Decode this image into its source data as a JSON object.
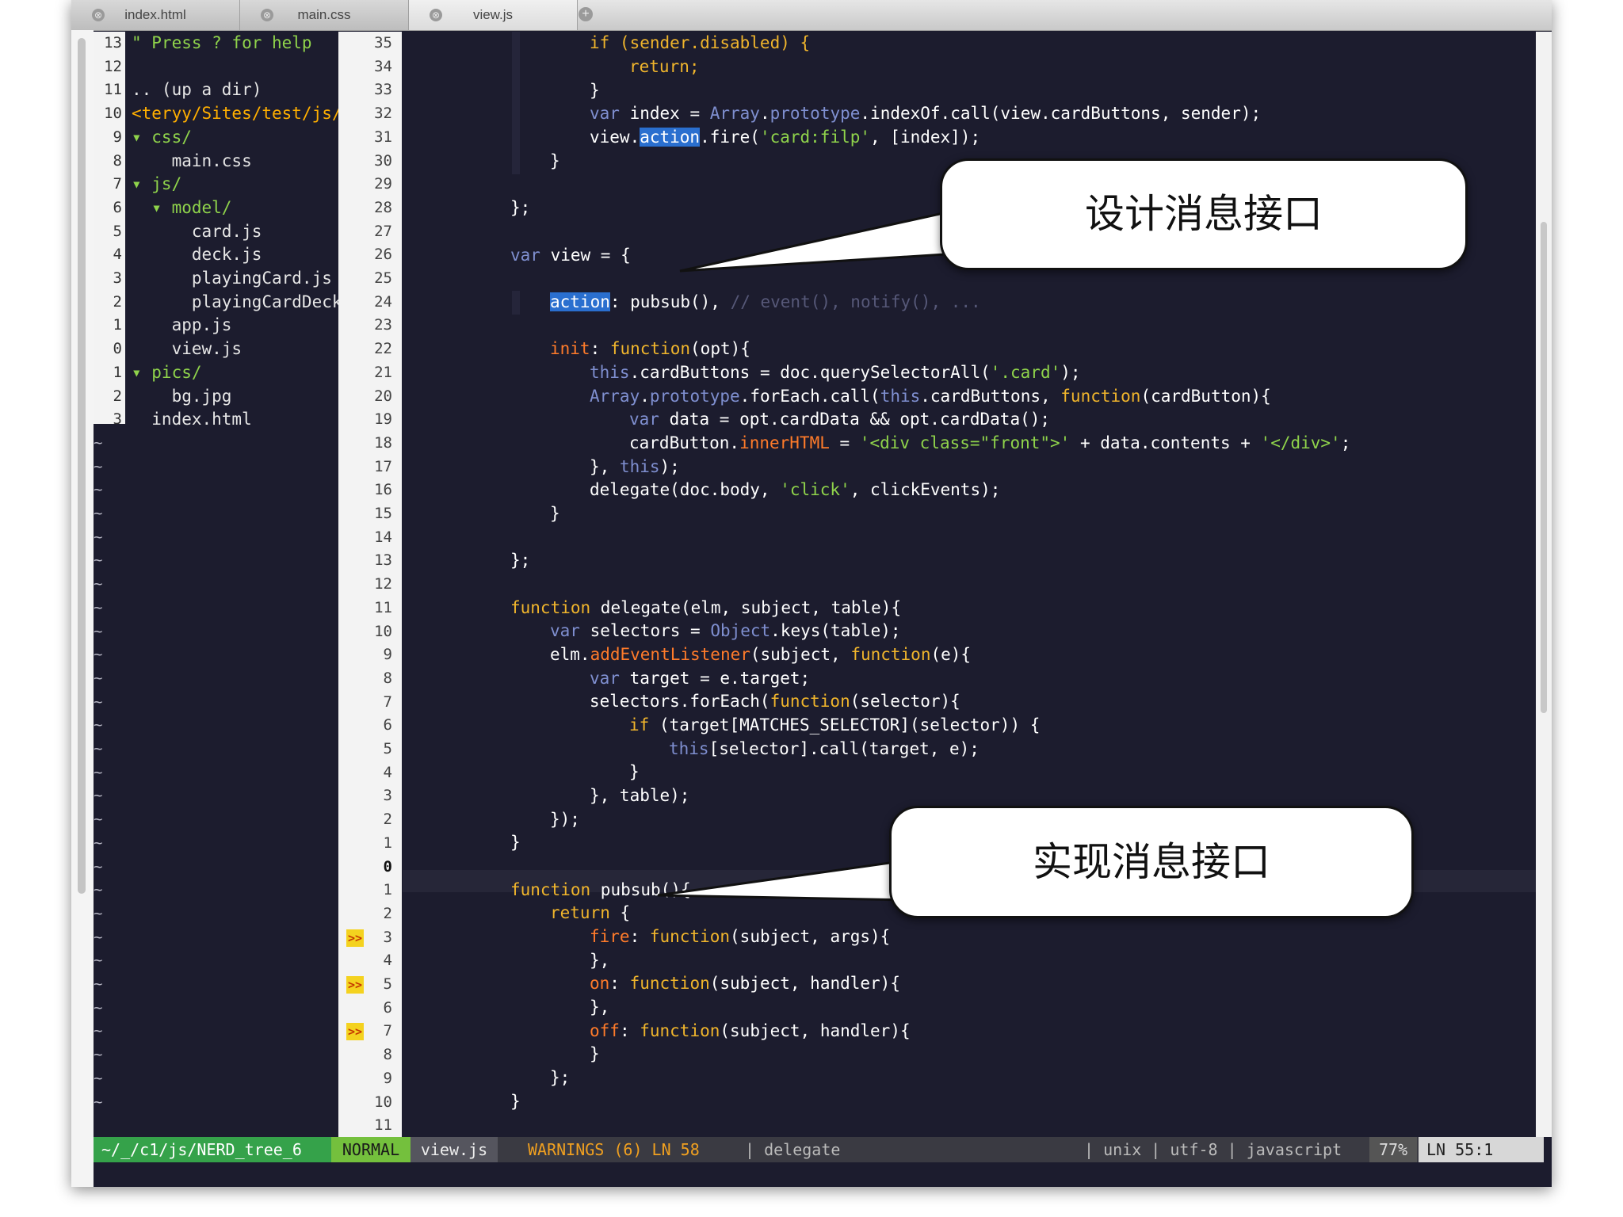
{
  "tabs": [
    {
      "label": "index.html",
      "close": "⊗"
    },
    {
      "label": "main.css",
      "close": "⊗"
    },
    {
      "label": "view.js",
      "close": "⊗"
    }
  ],
  "tab_new": "+",
  "tree": {
    "numbers": [
      "13",
      "12",
      "11",
      "10",
      "9",
      "8",
      "7",
      "6",
      "5",
      "4",
      "3",
      "2",
      "1",
      "0",
      "1",
      "2",
      "3"
    ],
    "lines": [
      "\" Press ? for help",
      "",
      ".. (up a dir)",
      "<teryy/Sites/test/js/",
      "▾ css/",
      "    main.css",
      "▾ js/",
      "  ▾ model/",
      "      card.js",
      "      deck.js",
      "      playingCard.js",
      "      playingCardDeck.js",
      "    app.js",
      "    view.js",
      "▾ pics/",
      "    bg.jpg",
      "  index.html"
    ],
    "tilde": "~"
  },
  "gutter": {
    "numbers": [
      "35",
      "34",
      "33",
      "32",
      "31",
      "30",
      "29",
      "28",
      "27",
      "26",
      "25",
      "24",
      "23",
      "22",
      "21",
      "20",
      "19",
      "18",
      "17",
      "16",
      "15",
      "14",
      "13",
      "12",
      "11",
      "10",
      "9",
      "8",
      "7",
      "6",
      "5",
      "4",
      "3",
      "2",
      "1",
      "0",
      "1",
      "2",
      "3",
      "4",
      "5",
      "6",
      "7",
      "8",
      "9",
      "10",
      "11"
    ],
    "sign": ">>"
  },
  "code": {
    "l35a": "if (sender.disabled) {",
    "l34a": "return;",
    "l33a": "}",
    "l32a": "var",
    "l32b": " index = ",
    "l32c": "Array",
    "l32d": ".",
    "l32e": "prototype",
    "l32f": ".indexOf.call(view.cardButtons, sender);",
    "l31a": "view.",
    "l31b": "action",
    "l31c": ".fire(",
    "l31d": "'card:filp'",
    "l31e": ", [index]);",
    "l30a": "}",
    "l28a": "};",
    "l26a": "var",
    "l26b": " view = {",
    "l24a": "action",
    "l24b": ": pubsub(), ",
    "l24c": "// event(), notify(), ...",
    "l22a": "init",
    "l22b": ": ",
    "l22c": "function",
    "l22d": "(opt){",
    "l21a": "this",
    "l21b": ".cardButtons = doc.querySelectorAll(",
    "l21c": "'.card'",
    "l21d": ");",
    "l20a": "Array",
    "l20b": ".",
    "l20c": "prototype",
    "l20d": ".forEach.call(",
    "l20e": "this",
    "l20f": ".cardButtons, ",
    "l20g": "function",
    "l20h": "(cardButton){",
    "l19a": "var",
    "l19b": " data = opt.cardData && opt.cardData();",
    "l18a": "cardButton.",
    "l18b": "innerHTML",
    "l18c": " = ",
    "l18d": "'<div class=\"front\">'",
    "l18e": " + data.contents + ",
    "l18f": "'</div>'",
    "l18g": ";",
    "l17a": "}, ",
    "l17b": "this",
    "l17c": ");",
    "l16a": "delegate(doc.body, ",
    "l16b": "'click'",
    "l16c": ", clickEvents);",
    "l15a": "}",
    "l13a": "};",
    "l11a": "function",
    "l11b": " delegate(elm, subject, table){",
    "l10a": "var",
    "l10b": " selectors = ",
    "l10c": "Object",
    "l10d": ".keys(table);",
    "l9a": "elm.",
    "l9b": "addEventListener",
    "l9c": "(subject, ",
    "l9d": "function",
    "l9e": "(e){",
    "l8a": "var",
    "l8b": " target = e.target;",
    "l7a": "selectors.forEach(",
    "l7b": "function",
    "l7c": "(selector){",
    "l6a": "if",
    "l6b": " (target[MATCHES_SELECTOR](selector)) {",
    "l5a": "this",
    "l5b": "[selector].call(target, e);",
    "l4a": "}",
    "l3a": "}, table);",
    "l2a": "});",
    "l1a": "}",
    "p1a": "function",
    "p1b": " pubsub(){",
    "p2a": "return",
    "p2b": " {",
    "p3a": "fire",
    "p3b": ": ",
    "p3c": "function",
    "p3d": "(subject, args){",
    "p4a": "},",
    "p5a": "on",
    "p5b": ": ",
    "p5c": "function",
    "p5d": "(subject, handler){",
    "p6a": "},",
    "p7a": "off",
    "p7b": ": ",
    "p7c": "function",
    "p7d": "(subject, handler){",
    "p8a": "}",
    "p9a": "};",
    "p10a": "}"
  },
  "status": {
    "tree": "~/_/c1/js/NERD_tree_6",
    "mode": "NORMAL",
    "file": "view.js",
    "warnings": "WARNINGS (6) LN 58",
    "function": "| delegate",
    "encoding": "| unix | utf-8 | javascript",
    "percent": "77%",
    "position": "LN  55:1"
  },
  "callouts": {
    "design": "设计消息接口",
    "implement": "实现消息接口"
  }
}
